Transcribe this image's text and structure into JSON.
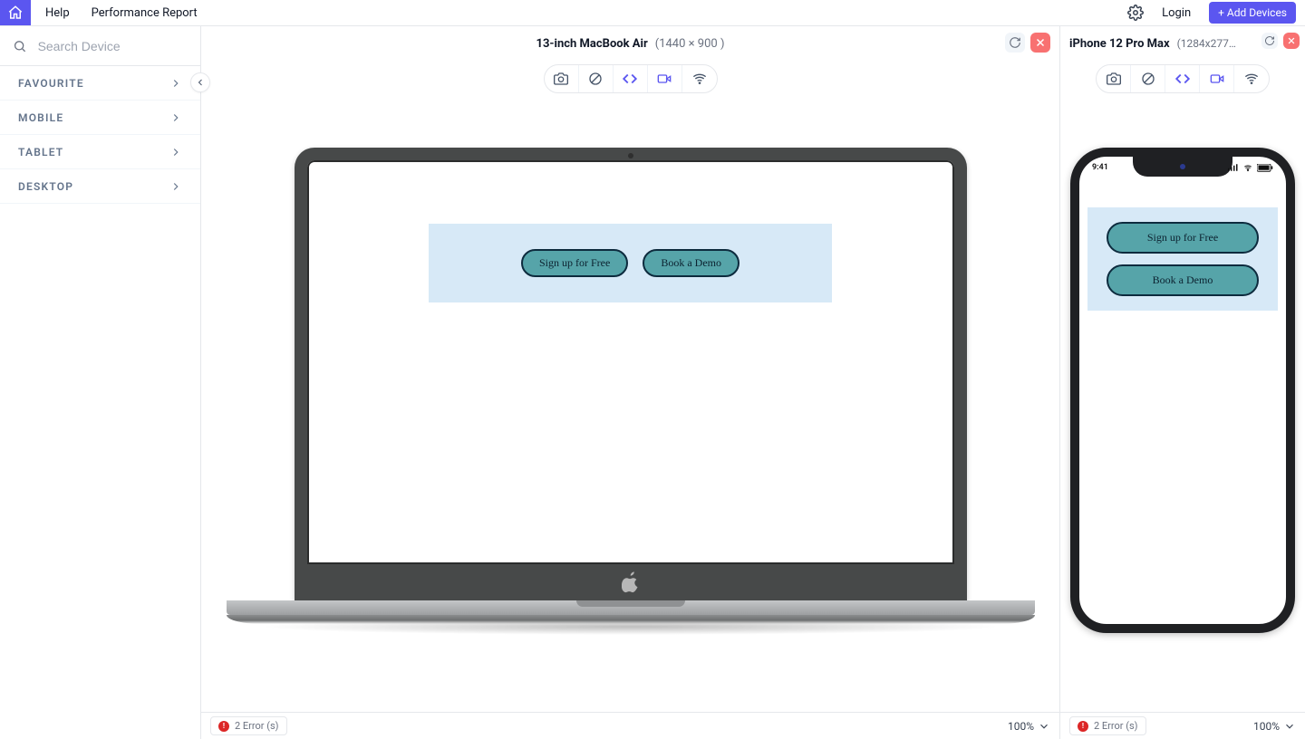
{
  "header": {
    "help": "Help",
    "performance": "Performance Report",
    "login": "Login",
    "add_devices": "+ Add Devices"
  },
  "sidebar": {
    "search_placeholder": "Search Device",
    "groups": [
      "FAVOURITE",
      "MOBILE",
      "TABLET",
      "DESKTOP"
    ]
  },
  "devices": {
    "macbook": {
      "name": "13-inch MacBook Air",
      "dims": "(1440 × 900 )",
      "errors": "2 Error (s)",
      "zoom": "100%",
      "preview_buttons": [
        "Sign up for Free",
        "Book a Demo"
      ]
    },
    "iphone": {
      "name": "iPhone 12 Pro Max",
      "dims": "(1284x277…",
      "errors": "2 Error (s)",
      "zoom": "100%",
      "status_time": "9:41",
      "preview_buttons": [
        "Sign up for Free",
        "Book a Demo"
      ]
    }
  }
}
